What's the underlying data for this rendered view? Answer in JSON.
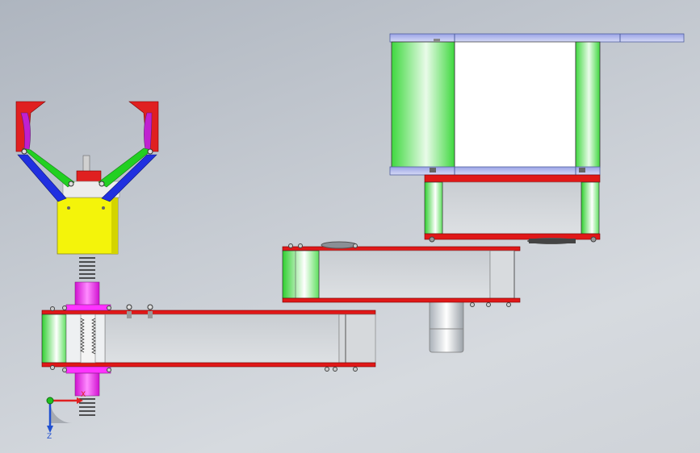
{
  "scene": {
    "description_free": true,
    "background": [
      "#aeb5bf",
      "#d6dadf"
    ]
  },
  "triad": {
    "x_label": "X",
    "z_label": "Z",
    "colors": {
      "x": "#e02020",
      "y": "#20c020",
      "z": "#2050d0"
    }
  },
  "colors": {
    "link_red": "#e01818",
    "pin_green": "#27d84a",
    "shaft_magenta": "#ff22ff",
    "gripper_box": "#f4f40a",
    "jaw_green": "#22d022",
    "jaw_blue": "#2030e0",
    "jaw_purple": "#b020d0",
    "motor_cap": "#b8bef0",
    "plate_grey": "#d0d4d8"
  }
}
